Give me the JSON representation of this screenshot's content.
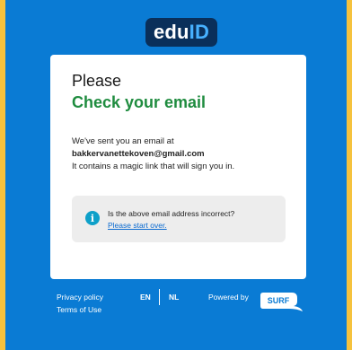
{
  "logo": {
    "part1": "edu",
    "part2": "ID"
  },
  "card": {
    "title_line1": "Please",
    "title_line2": "Check your email",
    "message_line1": "We've sent you an email at",
    "email": "bakkervanettekoven@gmail.com",
    "message_line3": "It contains a magic link that will sign you in."
  },
  "notice": {
    "icon": "info-icon",
    "question": "Is the above email address incorrect?",
    "link": "Please start over."
  },
  "footer": {
    "privacy": "Privacy policy",
    "terms": "Terms of Use",
    "lang_en": "EN",
    "lang_nl": "NL",
    "powered_by": "Powered by",
    "surf_logo": "SURF"
  },
  "colors": {
    "background_frame": "#f5c23e",
    "page_blue": "#0a7bd4",
    "logo_bg": "#0a2f5a",
    "logo_accent": "#47b1ff",
    "title_green": "#1f8c3f",
    "info_icon": "#0ea0c9",
    "link_blue": "#0a6ad0"
  }
}
